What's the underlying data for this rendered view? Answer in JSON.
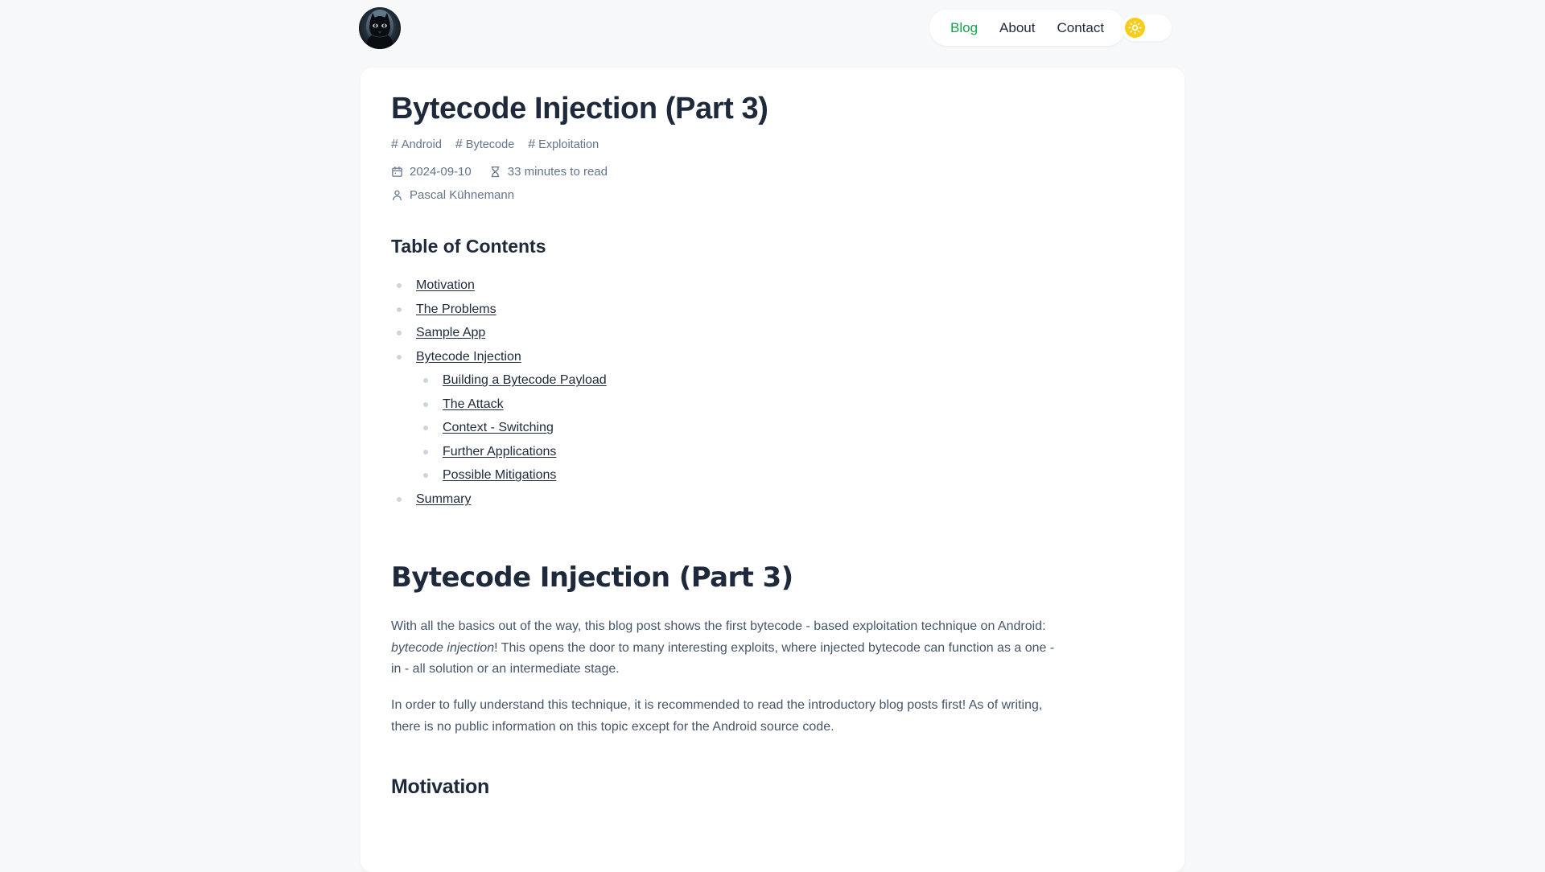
{
  "header": {
    "logo_alt": "Site logo avatar",
    "nav": [
      {
        "label": "Blog",
        "active": true
      },
      {
        "label": "About",
        "active": false
      },
      {
        "label": "Contact",
        "active": false
      }
    ],
    "theme_toggle": {
      "state": "light",
      "icon": "sun-icon",
      "icon_color": "#facc15"
    }
  },
  "post": {
    "title": "Bytecode Injection (Part 3)",
    "tags": [
      "Android",
      "Bytecode",
      "Exploitation"
    ],
    "meta": {
      "date_icon": "calendar-icon",
      "date": "2024-09-10",
      "readtime_icon": "hourglass-icon",
      "read_time": "33 minutes to read",
      "author_icon": "person-icon",
      "author": "Pascal Kühnemann"
    },
    "toc": {
      "heading": "Table of Contents",
      "items": [
        {
          "label": "Motivation",
          "children": []
        },
        {
          "label": "The Problems",
          "children": []
        },
        {
          "label": "Sample App",
          "children": []
        },
        {
          "label": "Bytecode Injection",
          "children": [
            {
              "label": "Building a Bytecode Payload"
            },
            {
              "label": "The Attack"
            },
            {
              "label": "Context - Switching"
            },
            {
              "label": "Further Applications"
            },
            {
              "label": "Possible Mitigations"
            }
          ]
        },
        {
          "label": "Summary",
          "children": []
        }
      ]
    },
    "body": {
      "heading": "Bytecode Injection (Part 3)",
      "paragraph_1_before": "With all the basics out of the way, this blog post shows the first bytecode - based exploitation technique on Android: ",
      "paragraph_1_italic": "bytecode injection",
      "paragraph_1_after": "! This opens the door to many interesting exploits, where injected bytecode can function as a one - in - all solution or an intermediate stage.",
      "paragraph_2": "In order to fully understand this technique, it is recommended to read the introductory blog posts first! As of writing, there is no public information on this topic except for the Android source code.",
      "section_heading": "Motivation"
    }
  },
  "colors": {
    "page_background": "#f7f8fa",
    "card_background": "#ffffff",
    "text_primary": "#1e293b",
    "text_muted": "#64748b",
    "accent_active": "#16a34a",
    "toggle_sun": "#facc15",
    "bullet": "#cbd5e1"
  }
}
